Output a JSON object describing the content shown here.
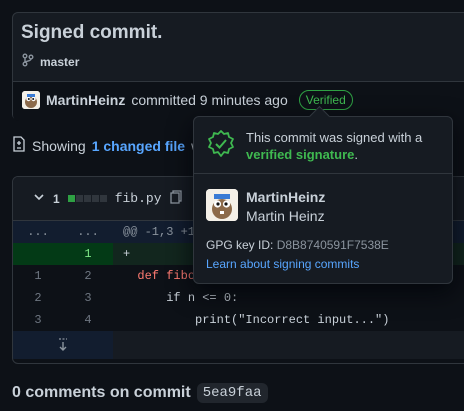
{
  "commit": {
    "title": "Signed commit.",
    "branch": "master",
    "author": "MartinHeinz",
    "action_text": "committed 9 minutes ago",
    "verified_label": "Verified"
  },
  "summary": {
    "prefix": "Showing",
    "changed_link": "1 changed file",
    "suffix": "w"
  },
  "diff": {
    "count": "1",
    "filename": "fib.py",
    "hunk_header": "@@ -1,3 +1",
    "hunk_dots": "...",
    "rows": [
      {
        "old": "",
        "new": "1",
        "sign": "+",
        "code": ""
      },
      {
        "old": "1",
        "new": "2",
        "sign": "",
        "code": "def fibo"
      },
      {
        "old": "2",
        "new": "3",
        "sign": "",
        "code": "if n <= 0:"
      },
      {
        "old": "3",
        "new": "4",
        "sign": "",
        "code": "print(\"Incorrect input...\")"
      }
    ],
    "stat_colors": [
      "#2ea043",
      "#30363d",
      "#30363d",
      "#30363d",
      "#30363d"
    ]
  },
  "comments": {
    "label": "0 comments on commit",
    "sha": "5ea9faa"
  },
  "popover": {
    "message_part1": "This commit was signed with a",
    "message_link": "verified signature",
    "message_end": ".",
    "login": "MartinHeinz",
    "full_name": "Martin Heinz",
    "gpg_label": "GPG key ID:",
    "gpg_key": "D8B8740591F7538E",
    "learn_link": "Learn about signing commits"
  },
  "colors": {
    "verified_green": "#3fb950",
    "link_blue": "#58a6ff",
    "bg": "#0d1117"
  }
}
